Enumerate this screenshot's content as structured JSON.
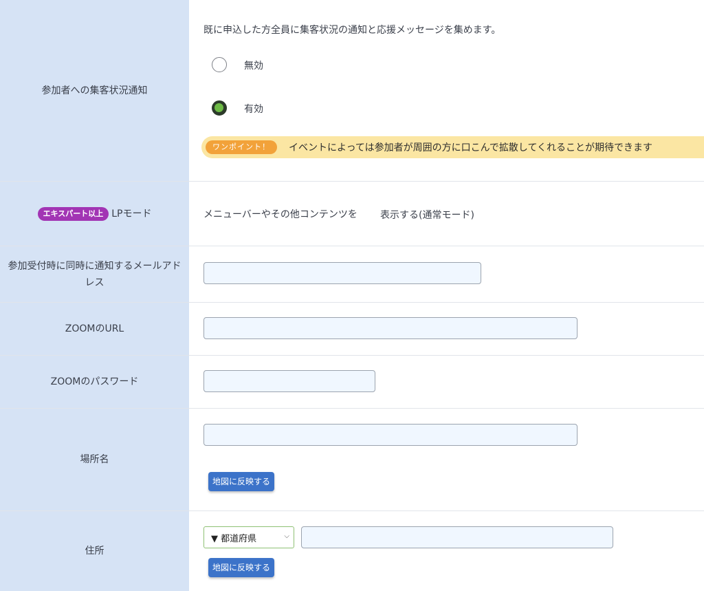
{
  "notify": {
    "label": "参加者への集客状況通知",
    "description": "既に申込した方全員に集客状況の通知と応援メッセージを集めます。",
    "options": [
      {
        "label": "無効",
        "checked": false
      },
      {
        "label": "有効",
        "checked": true
      }
    ],
    "onepoint_chip": "ワンポイント！",
    "onepoint_text": "イベントによっては参加者が周囲の方に口こんで拡散してくれることが期待できます"
  },
  "lp_mode": {
    "badge": "エキスパート以上",
    "label": "LPモード",
    "text_prefix": "メニューバーやその他コンテンツを",
    "text_value": "表示する(通常モード)"
  },
  "notify_email": {
    "label": "参加受付時に同時に通知するメールアドレス",
    "value": ""
  },
  "zoom_url": {
    "label": "ZOOMのURL",
    "value": ""
  },
  "zoom_password": {
    "label": "ZOOMのパスワード",
    "value": ""
  },
  "place_name": {
    "label": "場所名",
    "value": "",
    "map_button": "地図に反映する"
  },
  "address": {
    "label": "住所",
    "prefecture_selected": "▼ 都道府県",
    "value": "",
    "map_button": "地図に反映する"
  }
}
